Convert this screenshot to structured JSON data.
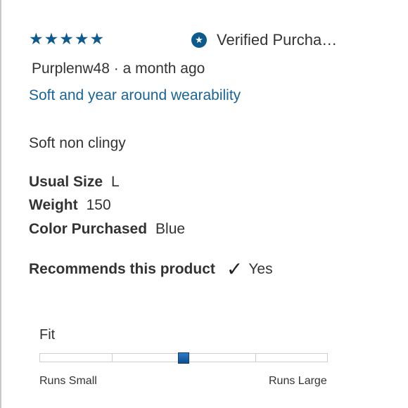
{
  "review": {
    "rating": 5,
    "star_glyph": "★",
    "verified_label": "Verified Purcha…",
    "verified_icon": "star-badge-icon",
    "reviewer": "Purplenw48",
    "separator": " · ",
    "posted": "a month ago",
    "title": "Soft and year around wearability",
    "body": "Soft non clingy"
  },
  "attributes": [
    {
      "label": "Usual Size",
      "value": "L"
    },
    {
      "label": "Weight",
      "value": "150"
    },
    {
      "label": "Color Purchased",
      "value": "Blue"
    }
  ],
  "recommend": {
    "label": "Recommends this product",
    "icon": "checkmark-icon",
    "value": "Yes"
  },
  "fit": {
    "label": "Fit",
    "min_label": "Runs Small",
    "max_label": "Runs Large",
    "value_fraction": 0.5,
    "segments": 4
  },
  "colors": {
    "accent": "#0f5a8c",
    "link": "#1a6396",
    "text": "#333333"
  }
}
